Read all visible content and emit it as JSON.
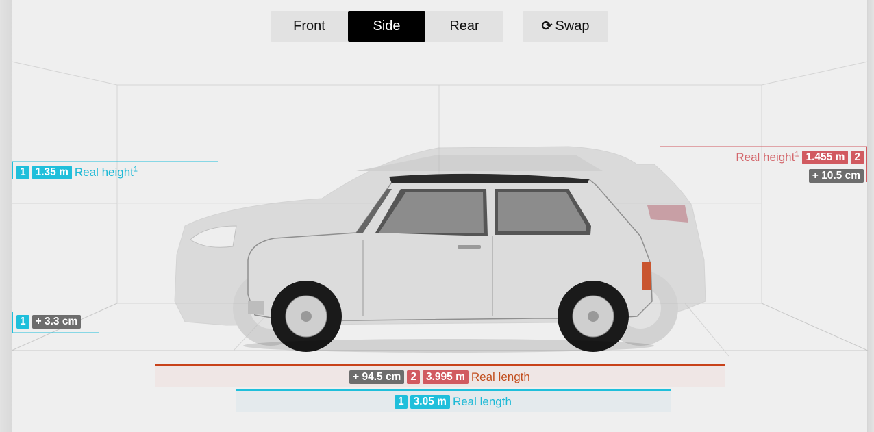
{
  "toolbar": {
    "front_label": "Front",
    "side_label": "Side",
    "rear_label": "Rear",
    "swap_label": "Swap",
    "swap_icon": "refresh-icon",
    "active": "Side"
  },
  "car1": {
    "index": "1",
    "height_value": "1.35 m",
    "height_label": "Real height",
    "height_sup": "1",
    "ground_offset": "+ 3.3 cm",
    "length_value": "3.05 m",
    "length_label": "Real length",
    "color": "#1fbfdb"
  },
  "car2": {
    "index": "2",
    "height_label": "Real height",
    "height_sup": "1",
    "height_value": "1.455 m",
    "height_diff": "+ 10.5 cm",
    "length_diff": "+ 94.5 cm",
    "length_value": "3.995 m",
    "length_label": "Real length",
    "color": "#d15a60"
  }
}
